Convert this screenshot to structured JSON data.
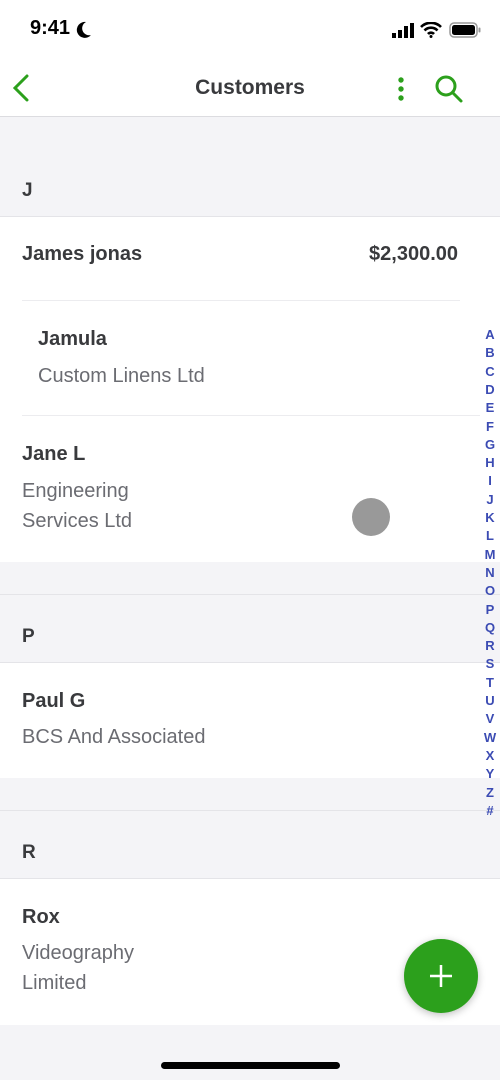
{
  "status": {
    "time": "9:41"
  },
  "nav": {
    "title": "Customers"
  },
  "colors": {
    "accent": "#2ca01c",
    "index": "#3b4bb3"
  },
  "sections": [
    {
      "letter": "J",
      "rows": [
        {
          "name": "James jonas",
          "amount": "$2,300.00"
        },
        {
          "name": "Jamula",
          "company": "Custom Linens Ltd"
        },
        {
          "name": "Jane L",
          "company_lines": [
            "Engineering",
            "Services Ltd"
          ]
        }
      ]
    },
    {
      "letter": "P",
      "rows": [
        {
          "name": "Paul G",
          "company": "BCS And Associated"
        }
      ]
    },
    {
      "letter": "R",
      "rows": [
        {
          "name": "Rox",
          "company_lines": [
            "Videography",
            "Limited"
          ]
        }
      ]
    }
  ],
  "index": [
    "A",
    "B",
    "C",
    "D",
    "E",
    "F",
    "G",
    "H",
    "I",
    "J",
    "K",
    "L",
    "M",
    "N",
    "O",
    "P",
    "Q",
    "R",
    "S",
    "T",
    "U",
    "V",
    "W",
    "X",
    "Y",
    "Z",
    "#"
  ]
}
